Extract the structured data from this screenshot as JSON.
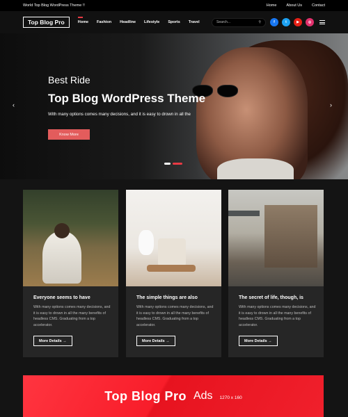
{
  "topbar": {
    "tagline": "World Top Blog WordPress Theme !!",
    "links": [
      "Home",
      "About Us",
      "Contact"
    ]
  },
  "header": {
    "logo": "Top Blog Pro",
    "nav": [
      "Home",
      "Fashion",
      "Headline",
      "Lifestyle",
      "Sports",
      "Travel"
    ],
    "search_placeholder": "Search...",
    "socials": [
      {
        "icon": "facebook-icon",
        "glyph": "f",
        "color": "#1877f2"
      },
      {
        "icon": "twitter-icon",
        "glyph": "t",
        "color": "#1da1f2"
      },
      {
        "icon": "youtube-icon",
        "glyph": "▶",
        "color": "#e62117"
      },
      {
        "icon": "instagram-icon",
        "glyph": "◎",
        "color": "#e1306c"
      }
    ]
  },
  "hero": {
    "subtitle": "Best Ride",
    "title": "Top Blog WordPress Theme",
    "description": "With many options comes many decisions, and it is easy to drown in all the",
    "button": "Know More",
    "prev": "‹",
    "next": "›"
  },
  "cards": [
    {
      "title": "Everyone seems to have",
      "text": "With many options comes many decisions, and it is easy to drown in all the many benefits of headless CMS. Graduating from a top accelerator.",
      "button": "More Details →"
    },
    {
      "title": "The simple things are also",
      "text": "With many options comes many decisions, and it is easy to drown in all the many benefits of headless CMS. Graduating from a top accelerator.",
      "button": "More Details →"
    },
    {
      "title": "The secret of life, though, is",
      "text": "With many options comes many decisions, and it is easy to drown in all the many benefits of headless CMS. Graduating from a top accelerator.",
      "button": "More Details →"
    }
  ],
  "ad": {
    "brand": "Top Blog Pro",
    "label": "Ads",
    "size": "1270 x 160"
  },
  "colors": {
    "accent": "#e83a44",
    "button": "#e35c5c",
    "ad": "#f81d2a"
  }
}
